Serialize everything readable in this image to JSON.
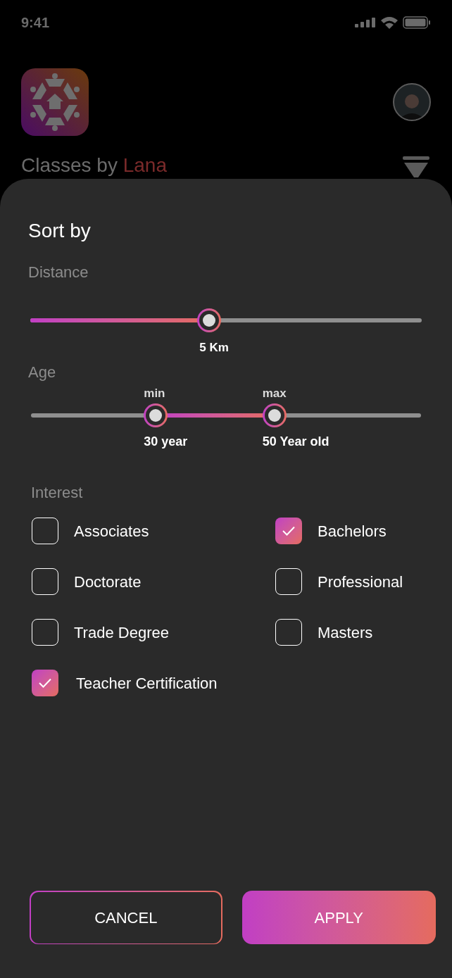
{
  "status_bar": {
    "time": "9:41"
  },
  "header": {
    "title": "Classes by ",
    "title_highlight": "Lana"
  },
  "sheet": {
    "title": "Sort by",
    "distance": {
      "label": "Distance",
      "level": 0.457,
      "value": "5 Km"
    },
    "age": {
      "label": "Age",
      "min": {
        "label": "min",
        "value": "30 year"
      },
      "max": {
        "label": "max",
        "value": "50 Year old"
      }
    },
    "interest": {
      "label": "Interest",
      "options": [
        {
          "label": "Associates",
          "checked": false
        },
        {
          "label": "Bachelors",
          "checked": true
        },
        {
          "label": "Doctorate",
          "checked": false
        },
        {
          "label": "Professional",
          "checked": false
        },
        {
          "label": "Trade Degree",
          "checked": false
        },
        {
          "label": "Masters",
          "checked": false
        },
        {
          "label": "Teacher Certification",
          "checked": true
        }
      ]
    },
    "buttons": {
      "cancel": "CANCEL",
      "apply": "APPLY"
    }
  }
}
